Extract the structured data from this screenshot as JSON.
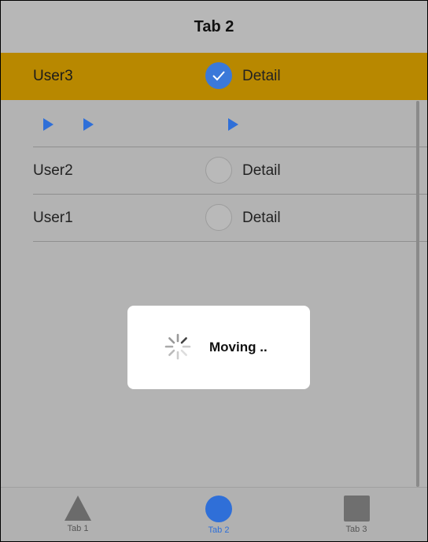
{
  "header": {
    "title": "Tab 2"
  },
  "list": {
    "items": [
      {
        "name": "User3",
        "detail": "Detail",
        "checked": true
      },
      {
        "name": "User2",
        "detail": "Detail",
        "checked": false
      },
      {
        "name": "User1",
        "detail": "Detail",
        "checked": false
      }
    ]
  },
  "toast": {
    "message": "Moving .."
  },
  "tabs": [
    {
      "label": "Tab 1",
      "icon": "triangle-icon"
    },
    {
      "label": "Tab 2",
      "icon": "circle-icon",
      "active": true
    },
    {
      "label": "Tab 3",
      "icon": "square-icon"
    }
  ],
  "colors": {
    "selected_row": "#b88800",
    "accent": "#2f6fd8"
  }
}
